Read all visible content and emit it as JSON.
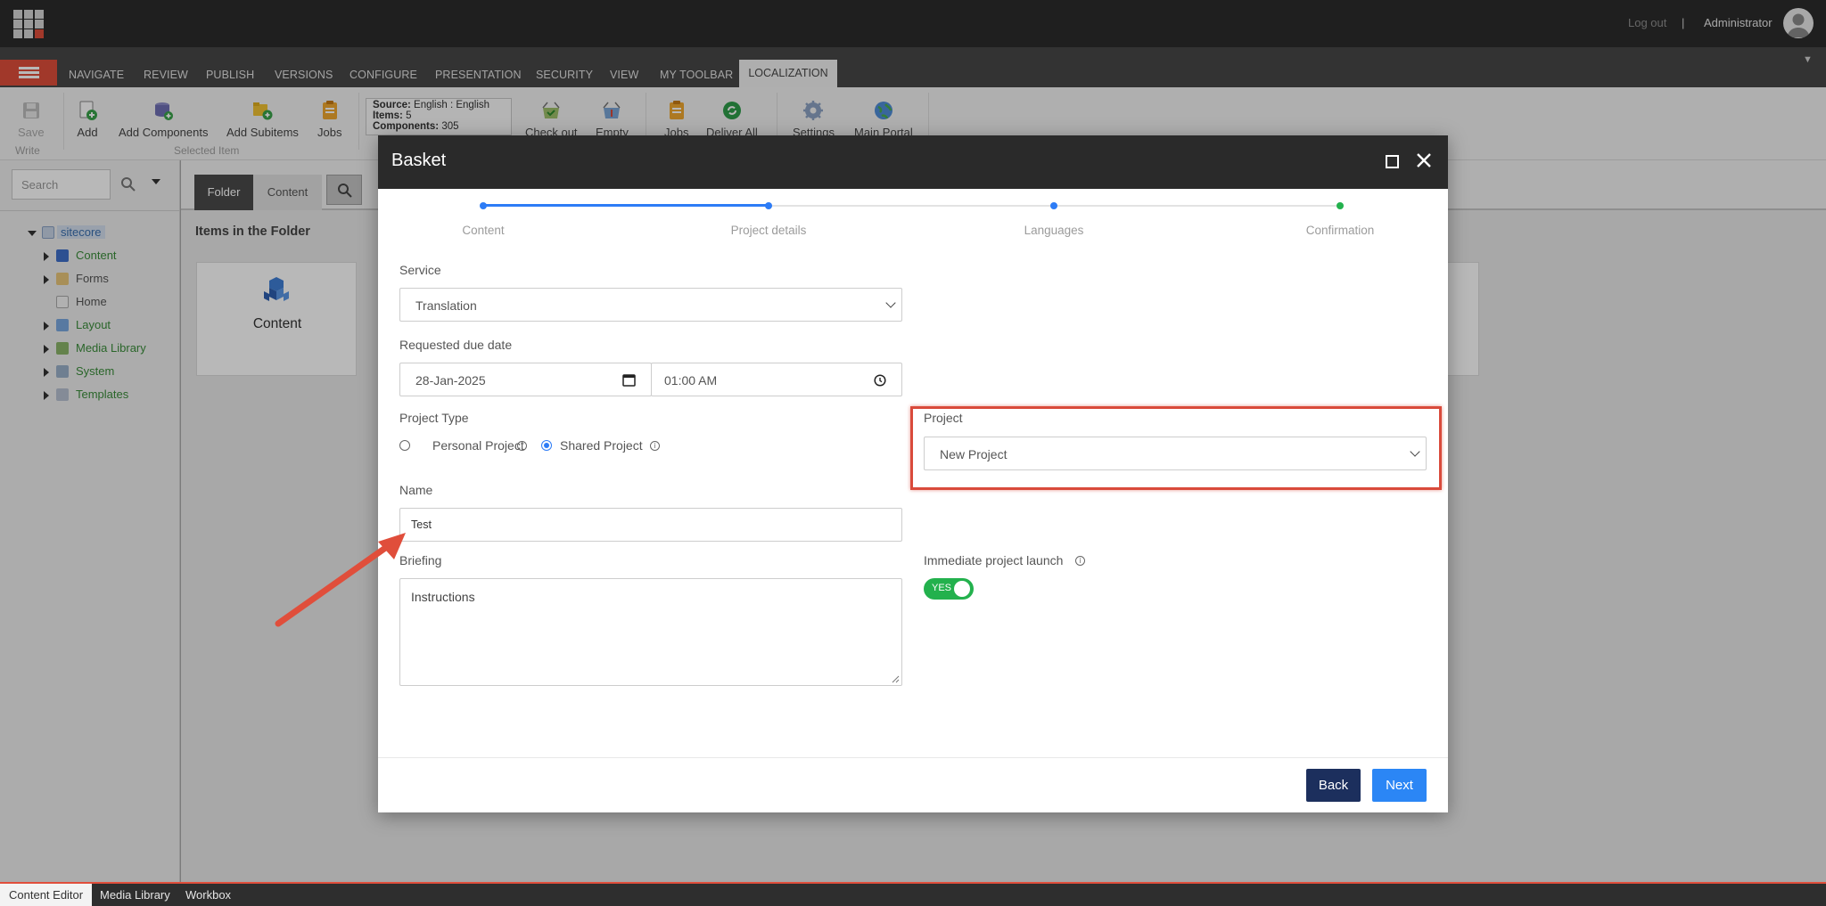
{
  "topbar": {
    "logout": "Log out",
    "separator": "|",
    "user": "Administrator"
  },
  "ribbon_tabs": [
    "NAVIGATE",
    "REVIEW",
    "PUBLISH",
    "VERSIONS",
    "CONFIGURE",
    "PRESENTATION",
    "SECURITY",
    "VIEW",
    "MY TOOLBAR"
  ],
  "ribbon_active_tab": "LOCALIZATION",
  "ribbon": {
    "save": "Save",
    "write_group": "Write",
    "add": "Add",
    "add_components": "Add Components",
    "add_subitems": "Add Subitems",
    "jobs": "Jobs",
    "selected_item_group": "Selected Item",
    "info": {
      "source_label": "Source:",
      "source_value": "English : English",
      "items_label": "Items:",
      "items_value": "5",
      "components_label": "Components:",
      "components_value": "305"
    },
    "check_out": "Check out",
    "empty": "Empty",
    "jobs2": "Jobs",
    "deliver_all": "Deliver All",
    "settings": "Settings",
    "main_portal": "Main Portal"
  },
  "left_panel": {
    "search_placeholder": "Search",
    "tree": {
      "root": "sitecore",
      "children": [
        "Content",
        "Forms",
        "Home",
        "Layout",
        "Media Library",
        "System",
        "Templates"
      ]
    }
  },
  "content_area": {
    "tab_folder": "Folder",
    "tab_content": "Content",
    "items_title": "Items in the Folder",
    "card_label": "Content"
  },
  "bottom_tabs": [
    "Content Editor",
    "Media Library",
    "Workbox"
  ],
  "modal": {
    "title": "Basket",
    "steps": [
      "Content",
      "Project details",
      "Languages",
      "Confirmation"
    ],
    "service_label": "Service",
    "service_value": "Translation",
    "due_label": "Requested due date",
    "due_date": "28-Jan-2025",
    "due_time": "01:00 AM",
    "project_type_label": "Project Type",
    "personal_project": "Personal Project",
    "shared_project": "Shared Project",
    "project_type_selected": "Shared Project",
    "project_label": "Project",
    "project_value": "New Project",
    "name_label": "Name",
    "name_value": "Test",
    "briefing_label": "Briefing",
    "briefing_value": "Instructions",
    "immediate_label": "Immediate project launch",
    "toggle_text": "YES",
    "toggle_on": true,
    "back": "Back",
    "next": "Next"
  },
  "colors": {
    "accent_red": "#e04e3b",
    "primary_blue": "#2b86f5",
    "navy": "#1c2f5d",
    "toggle_green": "#23b14d",
    "highlight_red": "#d94a3b"
  }
}
